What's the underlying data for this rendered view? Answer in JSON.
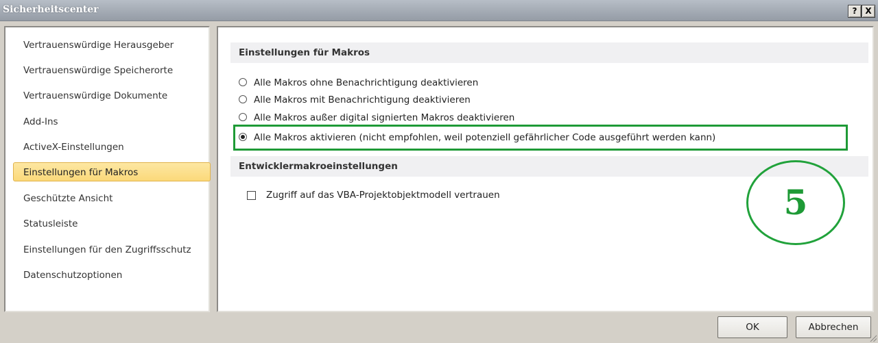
{
  "window": {
    "title": "Sicherheitscenter",
    "help_label": "?",
    "close_label": "X"
  },
  "sidebar": {
    "items": [
      {
        "label": "Vertrauenswürdige Herausgeber"
      },
      {
        "label": "Vertrauenswürdige Speicherorte"
      },
      {
        "label": "Vertrauenswürdige Dokumente"
      },
      {
        "label": "Add-Ins"
      },
      {
        "label": "ActiveX-Einstellungen"
      },
      {
        "label": "Einstellungen für Makros",
        "selected": true
      },
      {
        "label": "Geschützte Ansicht"
      },
      {
        "label": "Statusleiste"
      },
      {
        "label": "Einstellungen für den Zugriffsschutz"
      },
      {
        "label": "Datenschutzoptionen"
      }
    ]
  },
  "main": {
    "macro_section": {
      "title": "Einstellungen für Makros",
      "options": [
        {
          "label": "Alle Makros ohne Benachrichtigung deaktivieren",
          "checked": false
        },
        {
          "label": "Alle Makros mit Benachrichtigung deaktivieren",
          "checked": false
        },
        {
          "label": "Alle Makros außer digital signierten Makros deaktivieren",
          "checked": false
        },
        {
          "label": "Alle Makros aktivieren (nicht empfohlen, weil potenziell gefährlicher Code ausgeführt werden kann)",
          "checked": true
        }
      ]
    },
    "developer_section": {
      "title": "Entwicklermakroeinstellungen",
      "vba_checkbox_label": "Zugriff auf das VBA-Projektobjektmodell vertrauen",
      "vba_checked": false
    },
    "annotation": {
      "step_number": "5",
      "color": "#1e9a36"
    }
  },
  "footer": {
    "ok_label": "OK",
    "cancel_label": "Abbrechen"
  },
  "colors": {
    "selected_item": "#fbd97a",
    "highlight": "#1e9a36"
  }
}
